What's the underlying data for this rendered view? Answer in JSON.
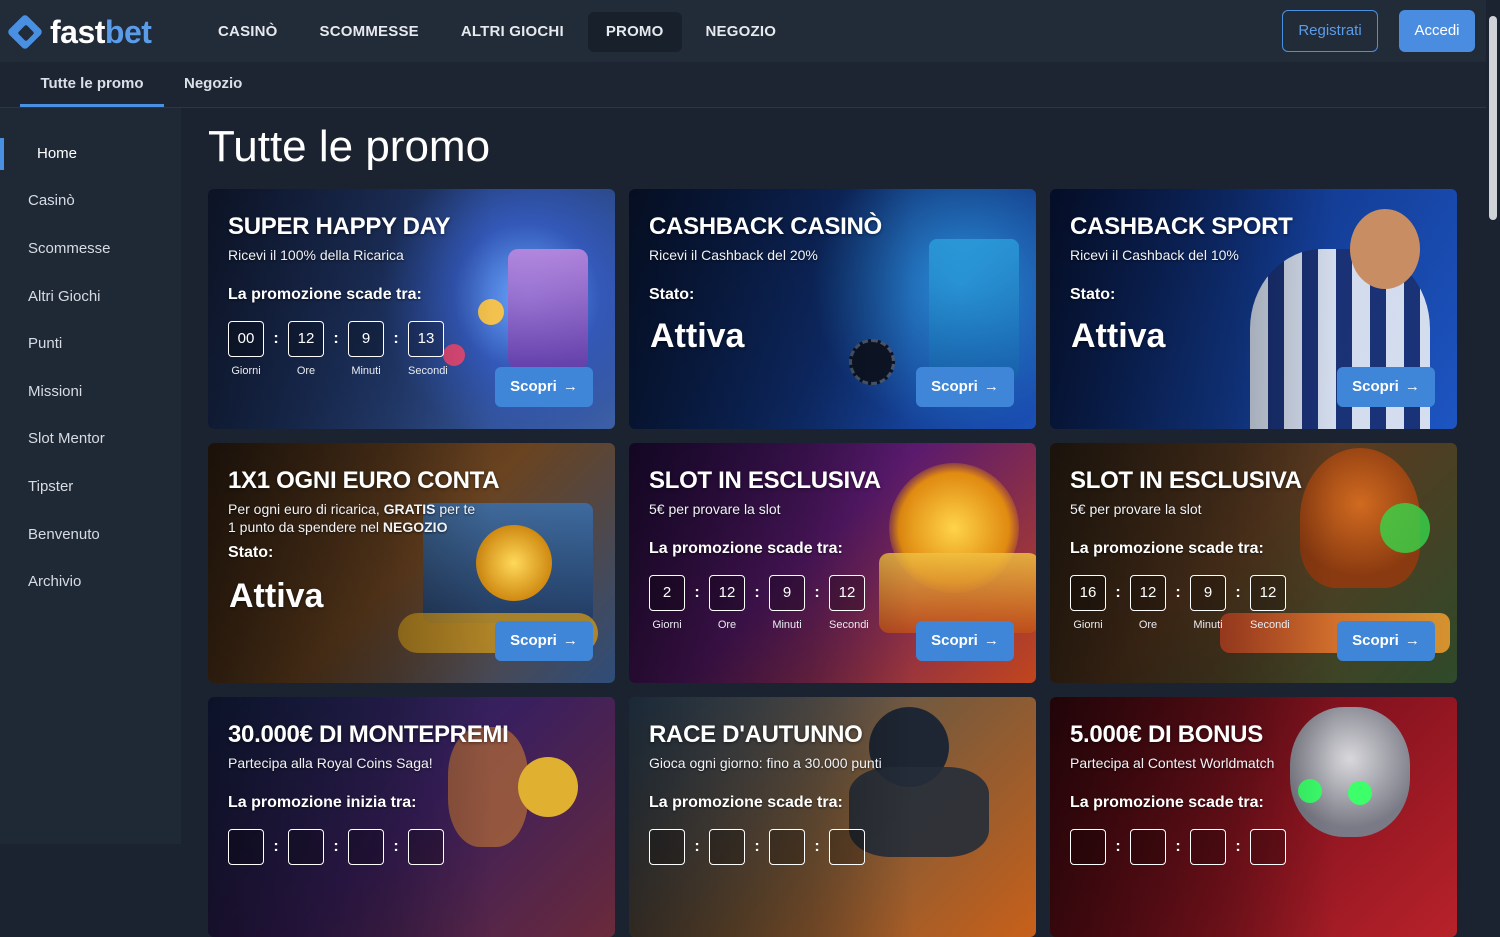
{
  "header": {
    "logo": {
      "part1": "fast",
      "part2": "bet"
    },
    "nav": [
      {
        "label": "CASINÒ",
        "active": false
      },
      {
        "label": "SCOMMESSE",
        "active": false
      },
      {
        "label": "ALTRI GIOCHI",
        "active": false
      },
      {
        "label": "PROMO",
        "active": true
      },
      {
        "label": "NEGOZIO",
        "active": false
      }
    ],
    "register_label": "Registrati",
    "login_label": "Accedi"
  },
  "subnav": [
    {
      "label": "Tutte le promo",
      "active": true
    },
    {
      "label": "Negozio",
      "active": false
    }
  ],
  "sidebar": [
    {
      "label": "Home",
      "active": true
    },
    {
      "label": "Casinò"
    },
    {
      "label": "Scommesse"
    },
    {
      "label": "Altri Giochi"
    },
    {
      "label": "Punti"
    },
    {
      "label": "Missioni"
    },
    {
      "label": "Slot Mentor"
    },
    {
      "label": "Tipster"
    },
    {
      "label": "Benvenuto"
    },
    {
      "label": "Archivio"
    }
  ],
  "page_title": "Tutte le promo",
  "cta_label": "Scopri",
  "cards": [
    {
      "title": "SUPER HAPPY DAY",
      "subtitle": "Ricevi il 100% della Ricarica",
      "label": "La promozione scade tra:",
      "timer": [
        "00",
        "12",
        "9",
        "13"
      ],
      "timer_labels": [
        "Giorni",
        "Ore",
        "Minuti",
        "Secondi"
      ]
    },
    {
      "title": "CASHBACK CASINÒ",
      "subtitle": "Ricevi il Cashback del 20%",
      "label": "Stato:",
      "status": "Attiva"
    },
    {
      "title": "CASHBACK SPORT",
      "subtitle": "Ricevi il Cashback del 10%",
      "label": "Stato:",
      "status": "Attiva"
    },
    {
      "title": "1X1 OGNI EURO CONTA",
      "subtitle_line1_a": "Per ogni euro di ricarica, ",
      "subtitle_line1_b": "GRATIS",
      "subtitle_line1_c": " per te",
      "subtitle_line2_a": "1 punto da spendere nel ",
      "subtitle_line2_b": "NEGOZIO",
      "label": "Stato:",
      "status": "Attiva"
    },
    {
      "title": "SLOT IN ESCLUSIVA",
      "subtitle": "5€ per provare la slot",
      "label": "La promozione scade tra:",
      "timer": [
        "2",
        "12",
        "9",
        "12"
      ],
      "timer_labels": [
        "Giorni",
        "Ore",
        "Minuti",
        "Secondi"
      ]
    },
    {
      "title": "SLOT IN ESCLUSIVA",
      "subtitle": "5€ per provare la slot",
      "label": "La promozione scade tra:",
      "timer": [
        "16",
        "12",
        "9",
        "12"
      ],
      "timer_labels": [
        "Giorni",
        "Ore",
        "Minuti",
        "Secondi"
      ]
    },
    {
      "title": "30.000€ DI MONTEPREMI",
      "subtitle": "Partecipa alla Royal Coins Saga!",
      "label": "La promozione inizia tra:"
    },
    {
      "title": "RACE D'AUTUNNO",
      "subtitle": "Gioca ogni giorno: fino a 30.000 punti",
      "label": "La promozione scade tra:"
    },
    {
      "title": "5.000€ DI BONUS",
      "subtitle": "Partecipa al Contest Worldmatch",
      "label": "La promozione scade tra:"
    }
  ]
}
